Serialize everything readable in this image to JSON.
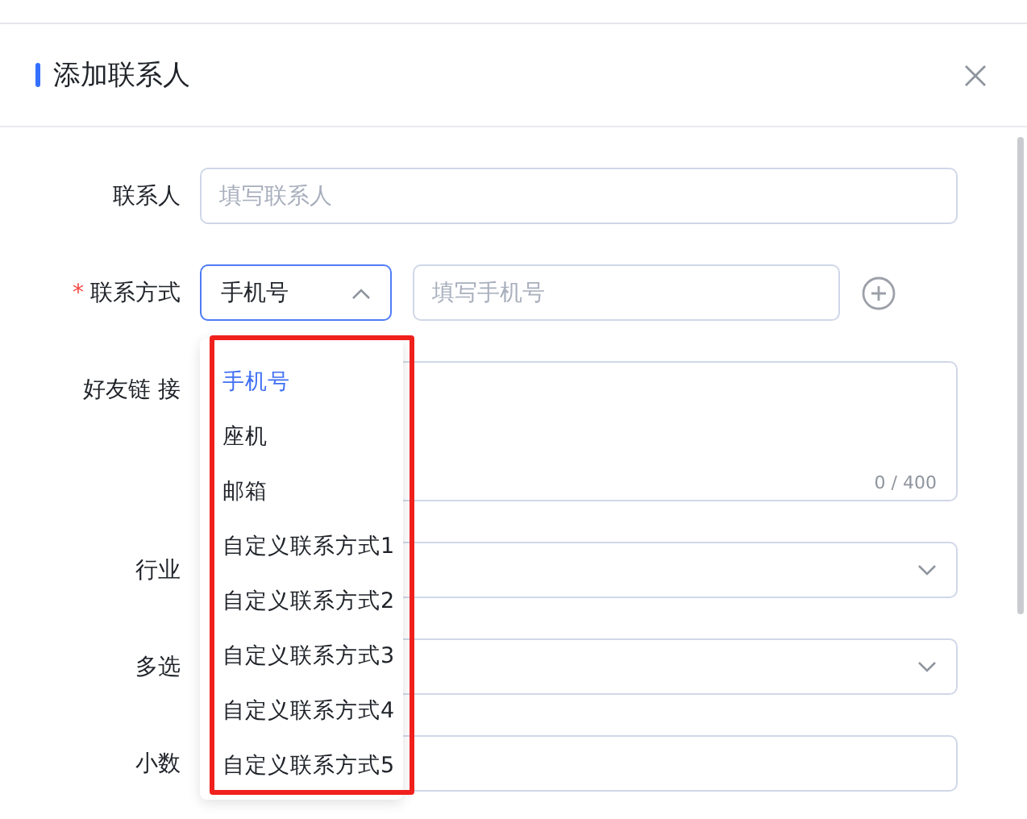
{
  "dialog": {
    "title": "添加联系人"
  },
  "fields": [
    {
      "kind": "input",
      "label": "联系人",
      "placeholder": "填写联系人"
    },
    {
      "kind": "contact",
      "label": "联系方式",
      "required_mark": "*",
      "select_value": "手机号",
      "open": true,
      "placeholder": "填写手机号"
    },
    {
      "kind": "textarea",
      "label": "好友链 接",
      "counter": "0 / 400"
    },
    {
      "kind": "select",
      "label": "行业"
    },
    {
      "kind": "select",
      "label": "多选"
    },
    {
      "kind": "input",
      "label": "小数"
    }
  ],
  "dropdown": {
    "options": [
      {
        "label": "手机号",
        "selected": true
      },
      {
        "label": "座机",
        "selected": false
      },
      {
        "label": "邮箱",
        "selected": false
      },
      {
        "label": "自定义联系方式1",
        "selected": false
      },
      {
        "label": "自定义联系方式2",
        "selected": false
      },
      {
        "label": "自定义联系方式3",
        "selected": false
      },
      {
        "label": "自定义联系方式4",
        "selected": false
      },
      {
        "label": "自定义联系方式5",
        "selected": false
      }
    ]
  }
}
